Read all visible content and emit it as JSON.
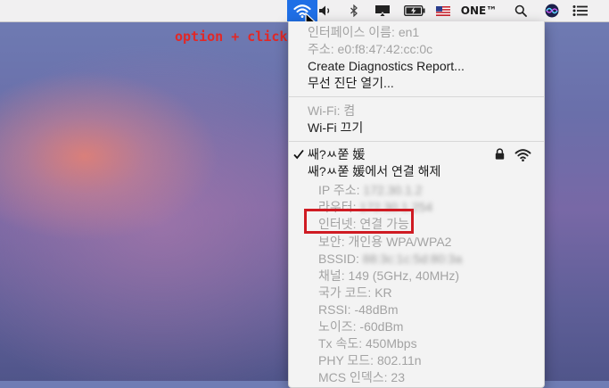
{
  "annotation": "option + click",
  "menubar": {
    "user_name": "ONE™"
  },
  "menu": {
    "interface_name": "인터페이스 이름: en1",
    "address": "주소: e0:f8:47:42:cc:0c",
    "create_report": "Create Diagnostics Report...",
    "open_wireless_diagnostics": "무선 진단 열기...",
    "wifi_status": "Wi-Fi: 켬",
    "wifi_off": "Wi-Fi 끄기",
    "network_name": "쌔?ㅆ쭏 媛",
    "disconnect": "쌔?ㅆ쭏 媛에서 연결 해제",
    "ip_label": "IP 주소:",
    "ip_value": "172.30.1.2",
    "router_label": "라우터:",
    "router_value": "172.30.1.254",
    "internet": "인터넷: 연결 가능",
    "security": "보안: 개인용 WPA/WPA2",
    "bssid_label": "BSSID:",
    "bssid_value": "88:3c:1c:5d:80:3a",
    "channel": "채널: 149 (5GHz, 40MHz)",
    "country": "국가 코드: KR",
    "rssi": "RSSI: -48dBm",
    "noise": "노이즈: -60dBm",
    "tx_rate": "Tx 속도: 450Mbps",
    "phy_mode": "PHY 모드: 802.11n",
    "mcs_index": "MCS 인덱스: 23"
  },
  "icons": [
    "wifi-icon",
    "volume-icon",
    "bluetooth-icon",
    "airplay-icon",
    "battery-icon",
    "us-flag-icon",
    "spotlight-search-icon",
    "siri-icon",
    "notification-center-icon",
    "checkmark-icon",
    "lock-icon",
    "wifi-signal-icon",
    "mouse-cursor-icon"
  ],
  "colors": {
    "selected": "#1f6fe6",
    "annotation": "#e22826",
    "highlight_box": "#cf1b23"
  }
}
